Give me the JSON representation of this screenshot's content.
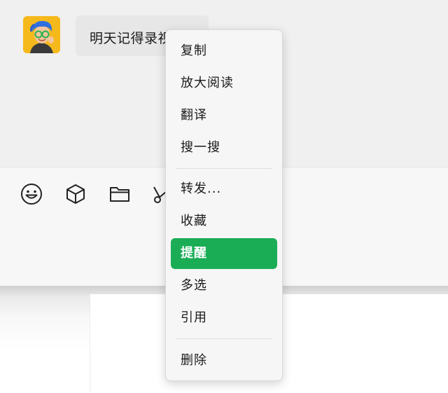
{
  "chat": {
    "message_text": "明天记得录视频"
  },
  "toolbar": {
    "icons": [
      "emoji-icon",
      "cube-icon",
      "folder-icon",
      "scissors-icon"
    ]
  },
  "context_menu": {
    "items": [
      {
        "label": "复制"
      },
      {
        "label": "放大阅读"
      },
      {
        "label": "翻译"
      },
      {
        "label": "搜一搜"
      },
      {
        "label": "转发..."
      },
      {
        "label": "收藏"
      },
      {
        "label": "提醒"
      },
      {
        "label": "多选"
      },
      {
        "label": "引用"
      },
      {
        "label": "删除"
      }
    ],
    "highlighted_item": "提醒",
    "highlight_color": "#1aad56"
  }
}
